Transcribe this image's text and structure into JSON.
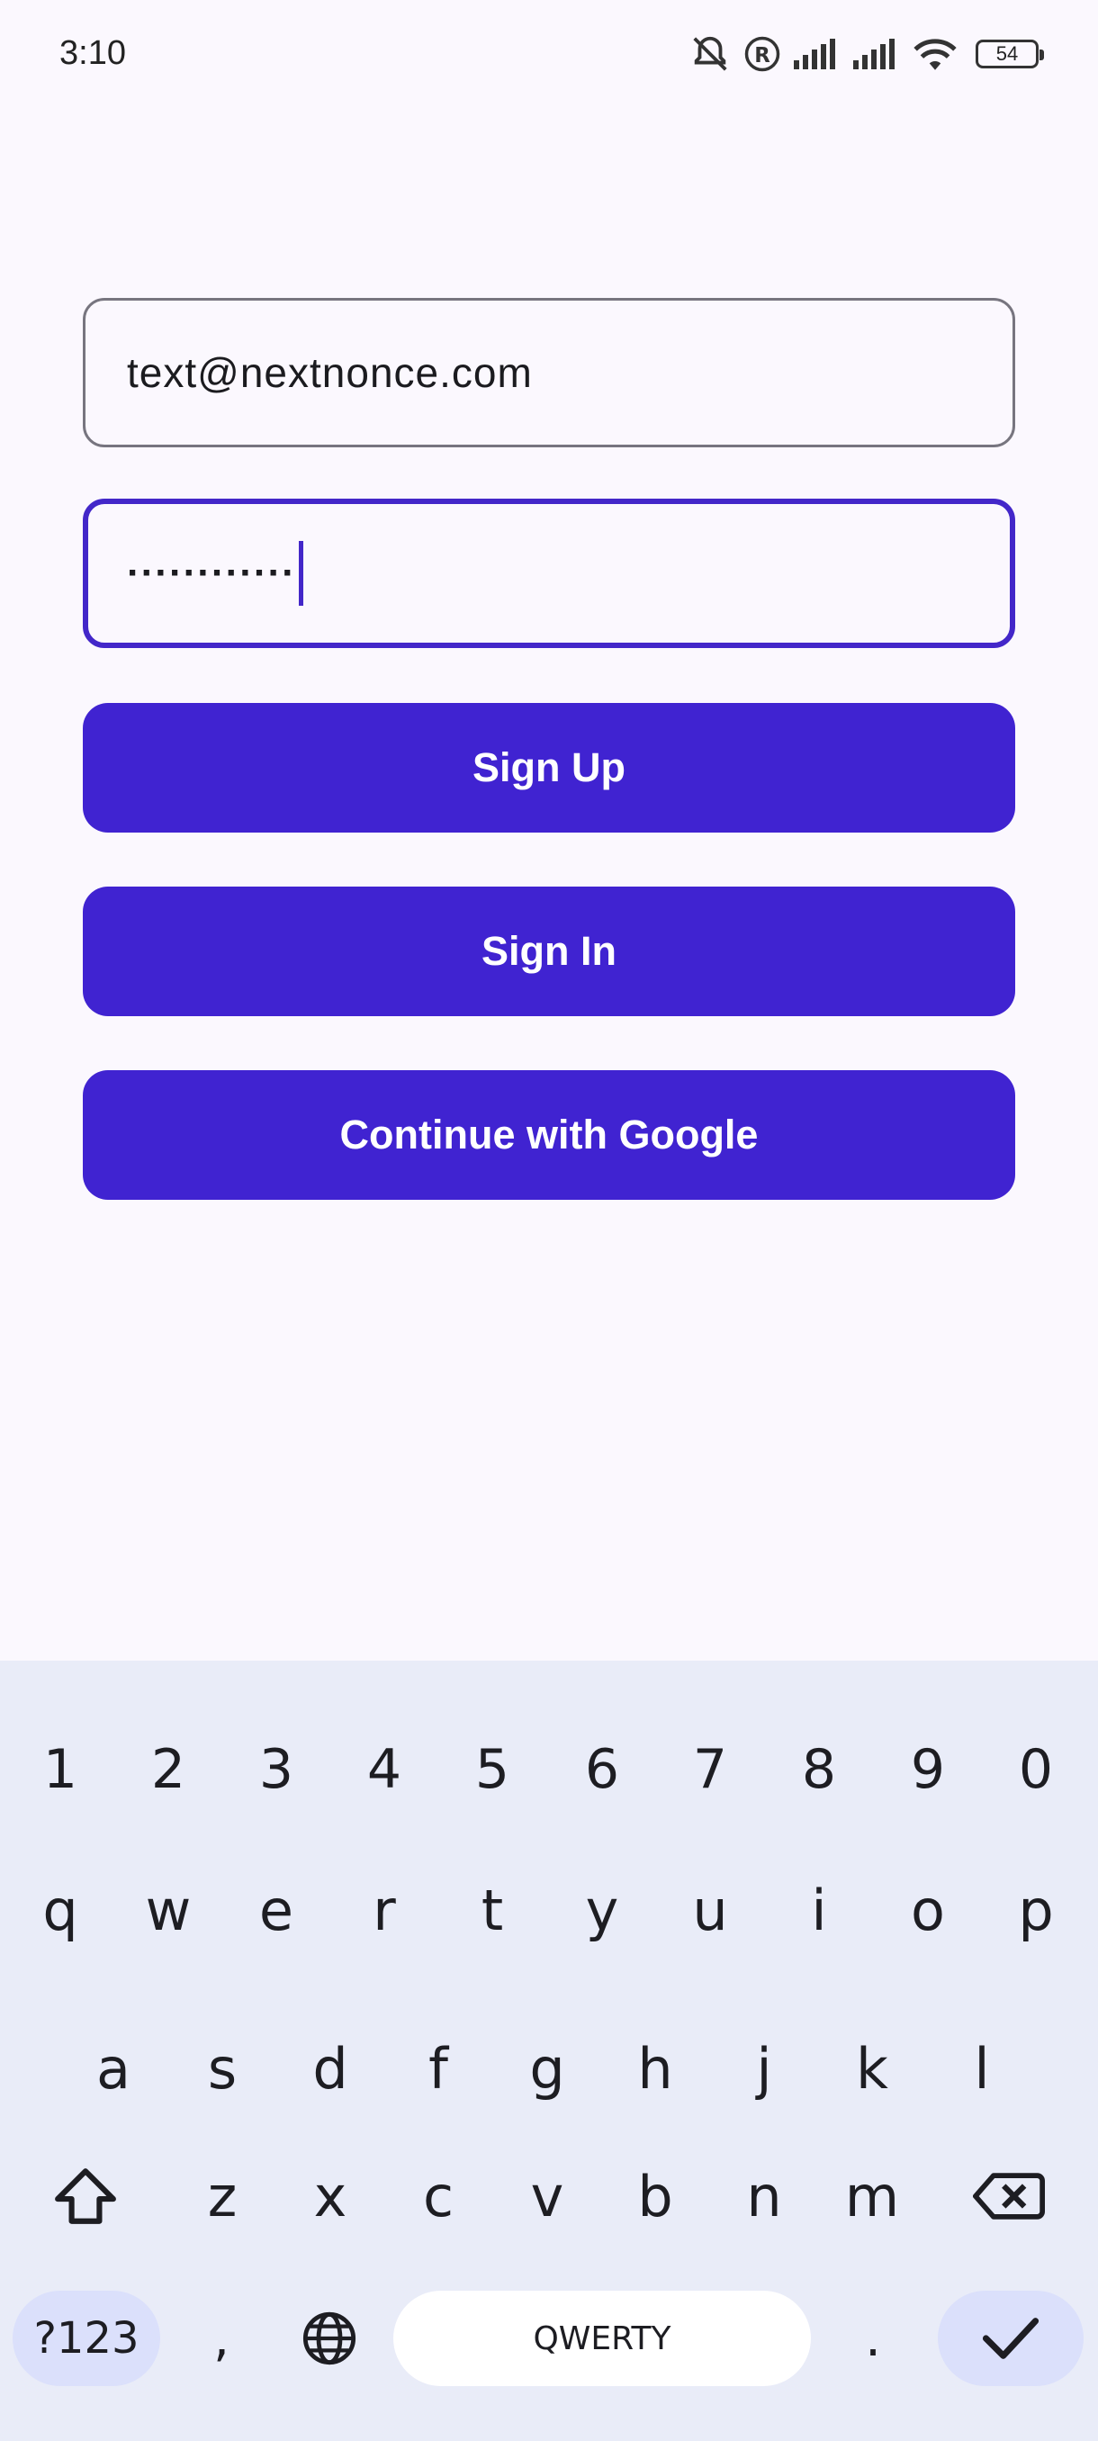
{
  "status_bar": {
    "time": "3:10",
    "battery": "54",
    "icons": [
      "mute-icon",
      "registered-icon",
      "signal-icon",
      "signal-icon",
      "wifi-icon",
      "battery-icon"
    ]
  },
  "form": {
    "email_value": "text@nextnonce.com",
    "password_masked": "············",
    "signup_label": "Sign Up",
    "signin_label": "Sign In",
    "google_label": "Continue with Google"
  },
  "keyboard": {
    "number_row": [
      "1",
      "2",
      "3",
      "4",
      "5",
      "6",
      "7",
      "8",
      "9",
      "0"
    ],
    "row1": [
      "q",
      "w",
      "e",
      "r",
      "t",
      "y",
      "u",
      "i",
      "o",
      "p"
    ],
    "row2": [
      "a",
      "s",
      "d",
      "f",
      "g",
      "h",
      "j",
      "k",
      "l"
    ],
    "row3": [
      "z",
      "x",
      "c",
      "v",
      "b",
      "n",
      "m"
    ],
    "symbols_label": "?123",
    "comma": ",",
    "space_label": "QWERTY",
    "period": "."
  },
  "colors": {
    "primary": "#4023d1",
    "focus_border": "#4327c9",
    "background": "#fbf8fe",
    "keyboard_bg": "#e9ecf8"
  }
}
